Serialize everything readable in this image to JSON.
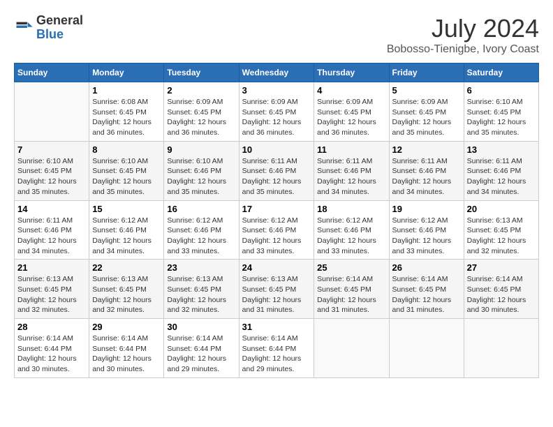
{
  "logo": {
    "general": "General",
    "blue": "Blue"
  },
  "title": "July 2024",
  "subtitle": "Bobosso-Tienigbe, Ivory Coast",
  "days_header": [
    "Sunday",
    "Monday",
    "Tuesday",
    "Wednesday",
    "Thursday",
    "Friday",
    "Saturday"
  ],
  "weeks": [
    [
      {
        "day": "",
        "sunrise": "",
        "sunset": "",
        "daylight": ""
      },
      {
        "day": "1",
        "sunrise": "Sunrise: 6:08 AM",
        "sunset": "Sunset: 6:45 PM",
        "daylight": "Daylight: 12 hours and 36 minutes."
      },
      {
        "day": "2",
        "sunrise": "Sunrise: 6:09 AM",
        "sunset": "Sunset: 6:45 PM",
        "daylight": "Daylight: 12 hours and 36 minutes."
      },
      {
        "day": "3",
        "sunrise": "Sunrise: 6:09 AM",
        "sunset": "Sunset: 6:45 PM",
        "daylight": "Daylight: 12 hours and 36 minutes."
      },
      {
        "day": "4",
        "sunrise": "Sunrise: 6:09 AM",
        "sunset": "Sunset: 6:45 PM",
        "daylight": "Daylight: 12 hours and 36 minutes."
      },
      {
        "day": "5",
        "sunrise": "Sunrise: 6:09 AM",
        "sunset": "Sunset: 6:45 PM",
        "daylight": "Daylight: 12 hours and 35 minutes."
      },
      {
        "day": "6",
        "sunrise": "Sunrise: 6:10 AM",
        "sunset": "Sunset: 6:45 PM",
        "daylight": "Daylight: 12 hours and 35 minutes."
      }
    ],
    [
      {
        "day": "7",
        "sunrise": "Sunrise: 6:10 AM",
        "sunset": "Sunset: 6:45 PM",
        "daylight": "Daylight: 12 hours and 35 minutes."
      },
      {
        "day": "8",
        "sunrise": "Sunrise: 6:10 AM",
        "sunset": "Sunset: 6:45 PM",
        "daylight": "Daylight: 12 hours and 35 minutes."
      },
      {
        "day": "9",
        "sunrise": "Sunrise: 6:10 AM",
        "sunset": "Sunset: 6:46 PM",
        "daylight": "Daylight: 12 hours and 35 minutes."
      },
      {
        "day": "10",
        "sunrise": "Sunrise: 6:11 AM",
        "sunset": "Sunset: 6:46 PM",
        "daylight": "Daylight: 12 hours and 35 minutes."
      },
      {
        "day": "11",
        "sunrise": "Sunrise: 6:11 AM",
        "sunset": "Sunset: 6:46 PM",
        "daylight": "Daylight: 12 hours and 34 minutes."
      },
      {
        "day": "12",
        "sunrise": "Sunrise: 6:11 AM",
        "sunset": "Sunset: 6:46 PM",
        "daylight": "Daylight: 12 hours and 34 minutes."
      },
      {
        "day": "13",
        "sunrise": "Sunrise: 6:11 AM",
        "sunset": "Sunset: 6:46 PM",
        "daylight": "Daylight: 12 hours and 34 minutes."
      }
    ],
    [
      {
        "day": "14",
        "sunrise": "Sunrise: 6:11 AM",
        "sunset": "Sunset: 6:46 PM",
        "daylight": "Daylight: 12 hours and 34 minutes."
      },
      {
        "day": "15",
        "sunrise": "Sunrise: 6:12 AM",
        "sunset": "Sunset: 6:46 PM",
        "daylight": "Daylight: 12 hours and 34 minutes."
      },
      {
        "day": "16",
        "sunrise": "Sunrise: 6:12 AM",
        "sunset": "Sunset: 6:46 PM",
        "daylight": "Daylight: 12 hours and 33 minutes."
      },
      {
        "day": "17",
        "sunrise": "Sunrise: 6:12 AM",
        "sunset": "Sunset: 6:46 PM",
        "daylight": "Daylight: 12 hours and 33 minutes."
      },
      {
        "day": "18",
        "sunrise": "Sunrise: 6:12 AM",
        "sunset": "Sunset: 6:46 PM",
        "daylight": "Daylight: 12 hours and 33 minutes."
      },
      {
        "day": "19",
        "sunrise": "Sunrise: 6:12 AM",
        "sunset": "Sunset: 6:46 PM",
        "daylight": "Daylight: 12 hours and 33 minutes."
      },
      {
        "day": "20",
        "sunrise": "Sunrise: 6:13 AM",
        "sunset": "Sunset: 6:45 PM",
        "daylight": "Daylight: 12 hours and 32 minutes."
      }
    ],
    [
      {
        "day": "21",
        "sunrise": "Sunrise: 6:13 AM",
        "sunset": "Sunset: 6:45 PM",
        "daylight": "Daylight: 12 hours and 32 minutes."
      },
      {
        "day": "22",
        "sunrise": "Sunrise: 6:13 AM",
        "sunset": "Sunset: 6:45 PM",
        "daylight": "Daylight: 12 hours and 32 minutes."
      },
      {
        "day": "23",
        "sunrise": "Sunrise: 6:13 AM",
        "sunset": "Sunset: 6:45 PM",
        "daylight": "Daylight: 12 hours and 32 minutes."
      },
      {
        "day": "24",
        "sunrise": "Sunrise: 6:13 AM",
        "sunset": "Sunset: 6:45 PM",
        "daylight": "Daylight: 12 hours and 31 minutes."
      },
      {
        "day": "25",
        "sunrise": "Sunrise: 6:14 AM",
        "sunset": "Sunset: 6:45 PM",
        "daylight": "Daylight: 12 hours and 31 minutes."
      },
      {
        "day": "26",
        "sunrise": "Sunrise: 6:14 AM",
        "sunset": "Sunset: 6:45 PM",
        "daylight": "Daylight: 12 hours and 31 minutes."
      },
      {
        "day": "27",
        "sunrise": "Sunrise: 6:14 AM",
        "sunset": "Sunset: 6:45 PM",
        "daylight": "Daylight: 12 hours and 30 minutes."
      }
    ],
    [
      {
        "day": "28",
        "sunrise": "Sunrise: 6:14 AM",
        "sunset": "Sunset: 6:44 PM",
        "daylight": "Daylight: 12 hours and 30 minutes."
      },
      {
        "day": "29",
        "sunrise": "Sunrise: 6:14 AM",
        "sunset": "Sunset: 6:44 PM",
        "daylight": "Daylight: 12 hours and 30 minutes."
      },
      {
        "day": "30",
        "sunrise": "Sunrise: 6:14 AM",
        "sunset": "Sunset: 6:44 PM",
        "daylight": "Daylight: 12 hours and 29 minutes."
      },
      {
        "day": "31",
        "sunrise": "Sunrise: 6:14 AM",
        "sunset": "Sunset: 6:44 PM",
        "daylight": "Daylight: 12 hours and 29 minutes."
      },
      {
        "day": "",
        "sunrise": "",
        "sunset": "",
        "daylight": ""
      },
      {
        "day": "",
        "sunrise": "",
        "sunset": "",
        "daylight": ""
      },
      {
        "day": "",
        "sunrise": "",
        "sunset": "",
        "daylight": ""
      }
    ]
  ]
}
